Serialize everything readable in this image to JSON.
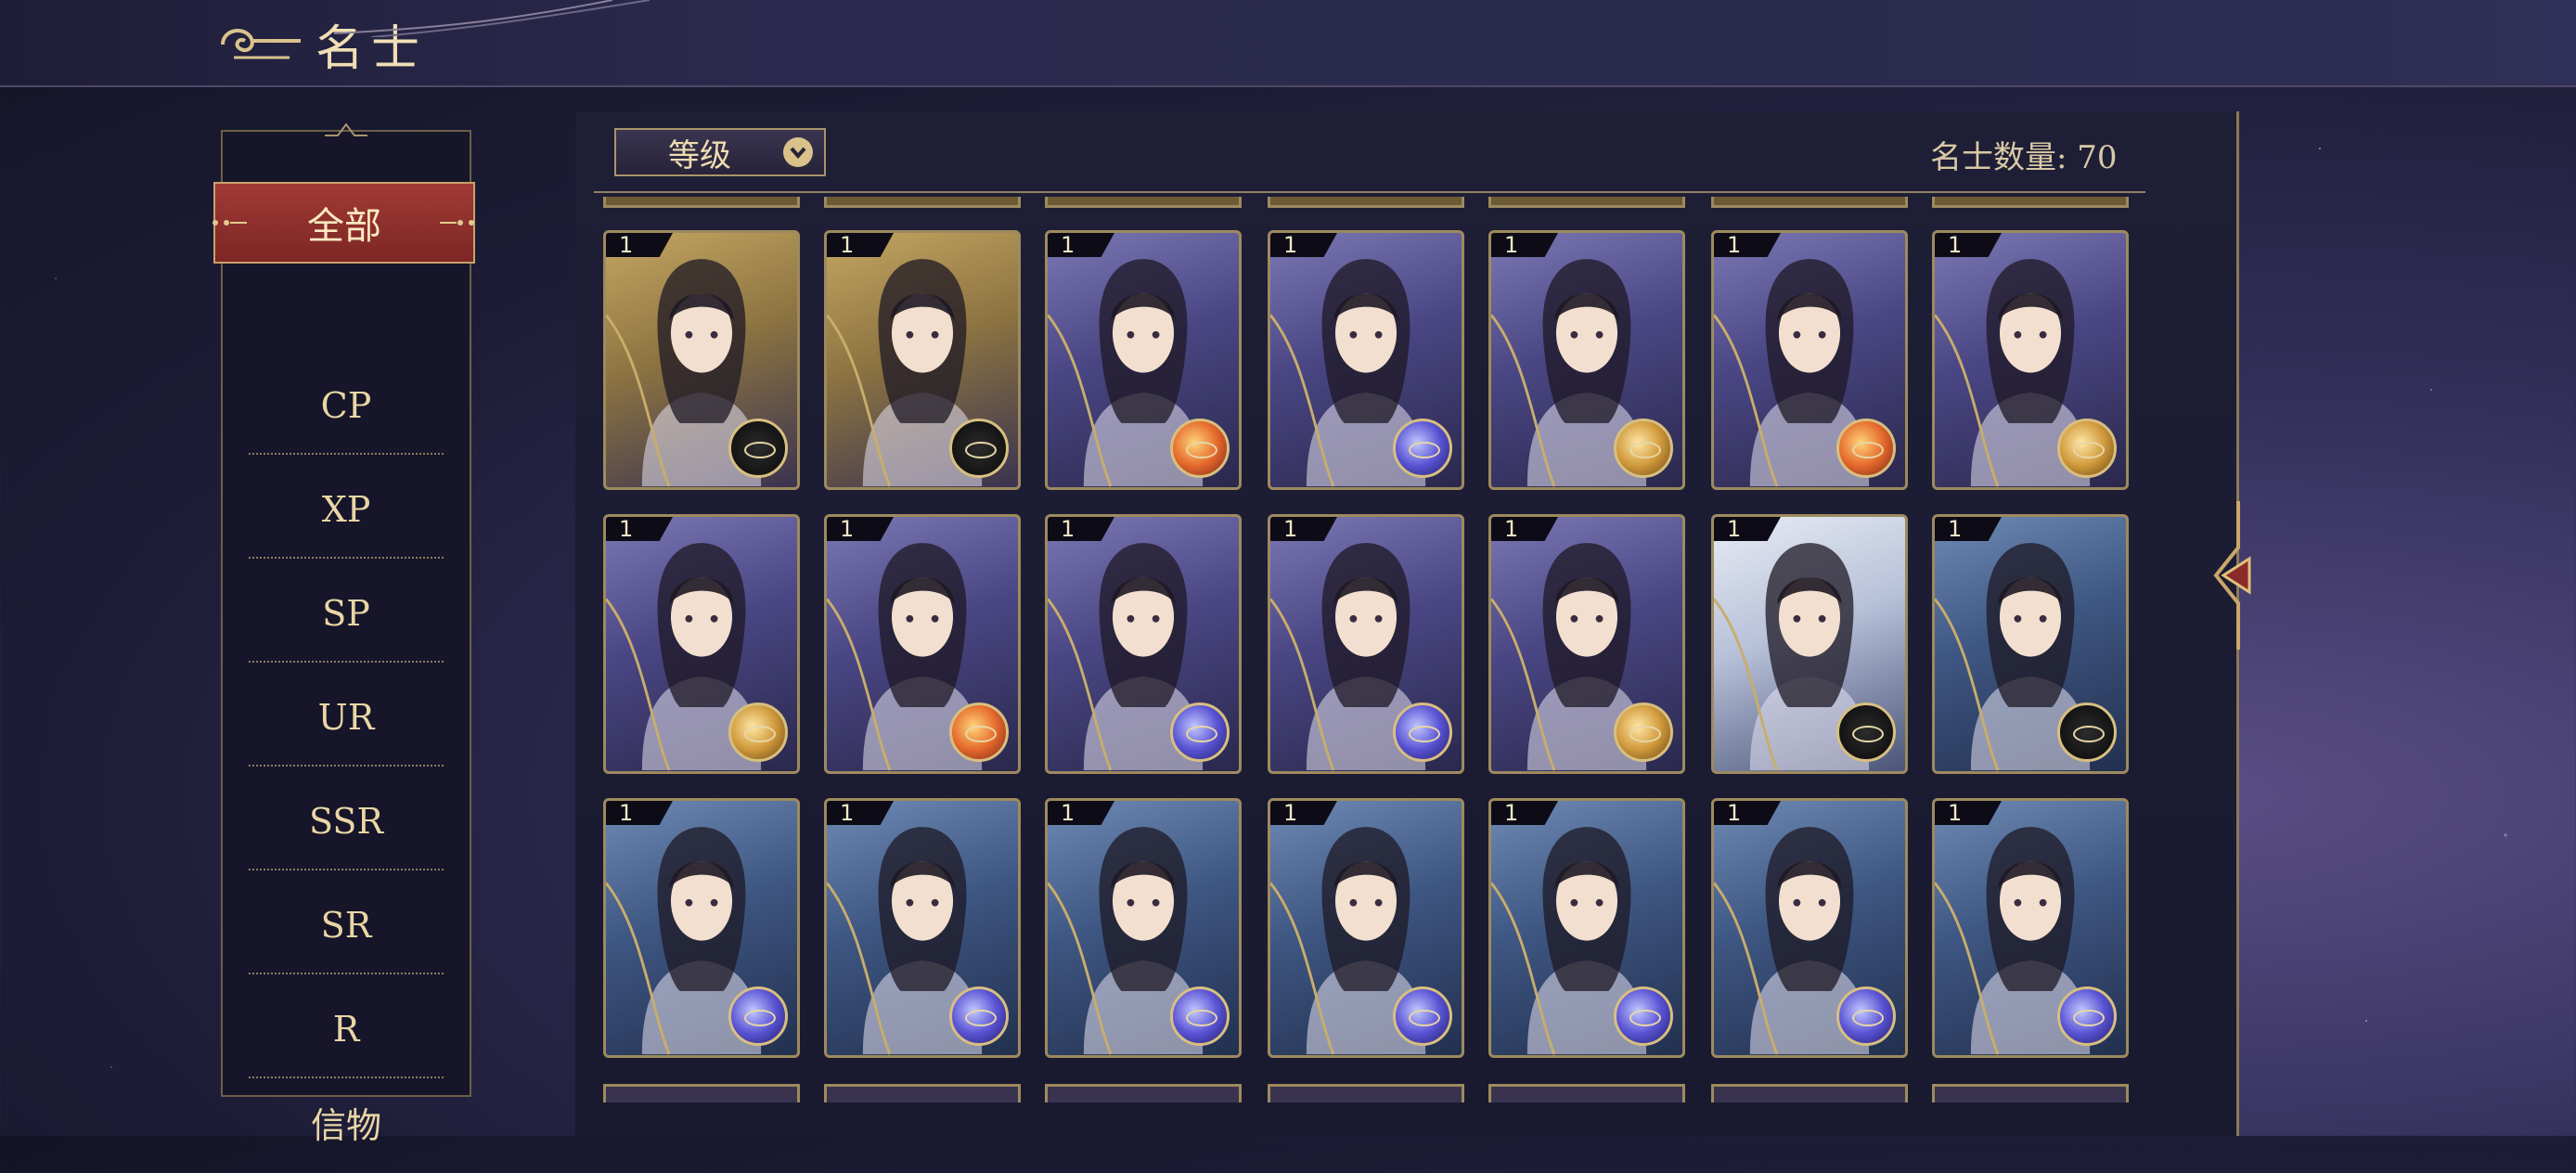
{
  "header": {
    "title": "名士"
  },
  "sidebar": {
    "active": "全部",
    "items": [
      "CP",
      "XP",
      "SP",
      "UR",
      "SSR",
      "SR",
      "R",
      "信物"
    ]
  },
  "toolbar": {
    "sort_label": "等级",
    "count_label": "名士数量: 70"
  },
  "cards": [
    {
      "level": "1",
      "bg": "gold",
      "emblem": "black"
    },
    {
      "level": "1",
      "bg": "gold",
      "emblem": "black"
    },
    {
      "level": "1",
      "bg": "purple",
      "emblem": "orange"
    },
    {
      "level": "1",
      "bg": "purple",
      "emblem": "blue"
    },
    {
      "level": "1",
      "bg": "purple",
      "emblem": "gold"
    },
    {
      "level": "1",
      "bg": "purple",
      "emblem": "orange"
    },
    {
      "level": "1",
      "bg": "purple",
      "emblem": "gold"
    },
    {
      "level": "1",
      "bg": "purple",
      "emblem": "gold"
    },
    {
      "level": "1",
      "bg": "purple",
      "emblem": "orange"
    },
    {
      "level": "1",
      "bg": "purple",
      "emblem": "blue"
    },
    {
      "level": "1",
      "bg": "purple",
      "emblem": "blue"
    },
    {
      "level": "1",
      "bg": "purple",
      "emblem": "gold"
    },
    {
      "level": "1",
      "bg": "pale",
      "emblem": "black"
    },
    {
      "level": "1",
      "bg": "blue",
      "emblem": "black"
    },
    {
      "level": "1",
      "bg": "blue",
      "emblem": "blue"
    },
    {
      "level": "1",
      "bg": "blue",
      "emblem": "blue"
    },
    {
      "level": "1",
      "bg": "blue",
      "emblem": "blue"
    },
    {
      "level": "1",
      "bg": "blue",
      "emblem": "blue"
    },
    {
      "level": "1",
      "bg": "blue",
      "emblem": "blue"
    },
    {
      "level": "1",
      "bg": "blue",
      "emblem": "blue"
    },
    {
      "level": "1",
      "bg": "blue",
      "emblem": "blue"
    }
  ],
  "colors": {
    "accent_red": "#8f2f2c",
    "gold_border": "#9e8a5e",
    "text_gold": "#e9d6a4"
  }
}
